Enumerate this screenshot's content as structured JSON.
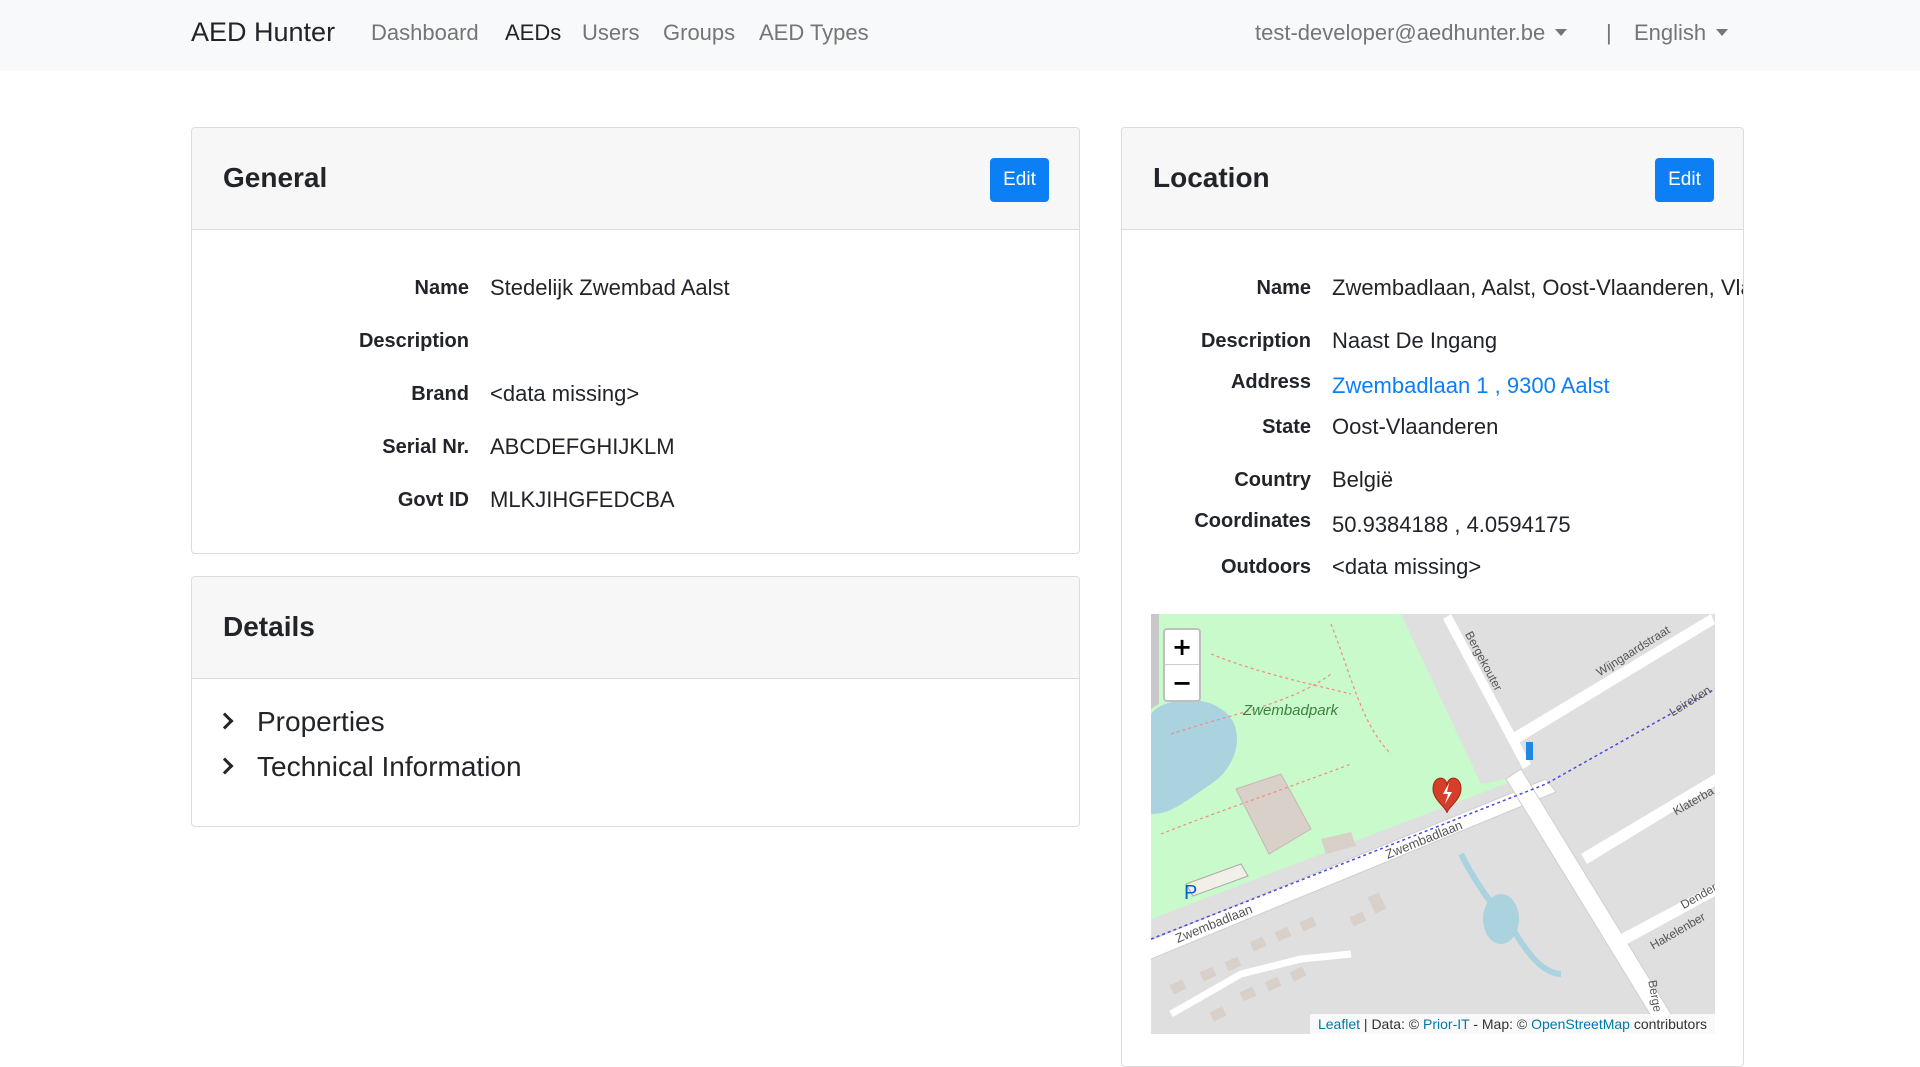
{
  "navbar": {
    "brand": "AED Hunter",
    "links": [
      "Dashboard",
      "AEDs",
      "Users",
      "Groups",
      "AED Types"
    ],
    "active": "AEDs",
    "user": "test-developer@aedhunter.be",
    "separator": "|",
    "language": "English"
  },
  "general": {
    "title": "General",
    "edit_label": "Edit",
    "fields": [
      {
        "label": "Name",
        "value": "Stedelijk Zwembad Aalst"
      },
      {
        "label": "Description",
        "value": ""
      },
      {
        "label": "Brand",
        "value": "<data missing>"
      },
      {
        "label": "Serial Nr.",
        "value": "ABCDEFGHIJKLM"
      },
      {
        "label": "Govt ID",
        "value": "MLKJIHGFEDCBA"
      }
    ]
  },
  "details": {
    "title": "Details",
    "items": [
      "Properties",
      "Technical Information"
    ]
  },
  "location": {
    "title": "Location",
    "edit_label": "Edit",
    "fields": [
      {
        "label": "Name",
        "value": "Zwembadlaan, Aalst, Oost-Vlaanderen, Vlaanderen"
      },
      {
        "label": "Description",
        "value": "Naast De Ingang"
      },
      {
        "label": "Address",
        "value": "Zwembadlaan 1 , 9300 Aalst"
      },
      {
        "label": "State",
        "value": "Oost-Vlaanderen"
      },
      {
        "label": "Country",
        "value": "België"
      },
      {
        "label": "Coordinates",
        "value": "50.9384188 , 4.0594175"
      },
      {
        "label": "Outdoors",
        "value": "<data missing>"
      }
    ]
  },
  "map": {
    "zoom_in": "+",
    "zoom_out": "−",
    "labels": {
      "park": "Zwembadpark",
      "street_main": "Zwembadlaan",
      "street_main_2": "Zwembadlaan",
      "street_bergekouter": "Bergekouter",
      "street_wijngaard": "Wijngaardstraat",
      "street_leireken": "Leireken",
      "street_klaterba": "Klaterba",
      "street_dender": "Dender",
      "street_hakelenber": "Hakelenber",
      "street_berge": "Berge",
      "parking": "P"
    },
    "attribution": {
      "leaflet": "Leaflet",
      "sep1": " | Data: © ",
      "prior_it": "Prior-IT",
      "sep2": " - Map: © ",
      "osm": "OpenStreetMap",
      "suffix": " contributors"
    },
    "colors": {
      "park": "#c8facc",
      "water": "#aad3df",
      "road": "#ffffff",
      "building": "#d9d0c9",
      "marker": "#d63e2a"
    }
  }
}
